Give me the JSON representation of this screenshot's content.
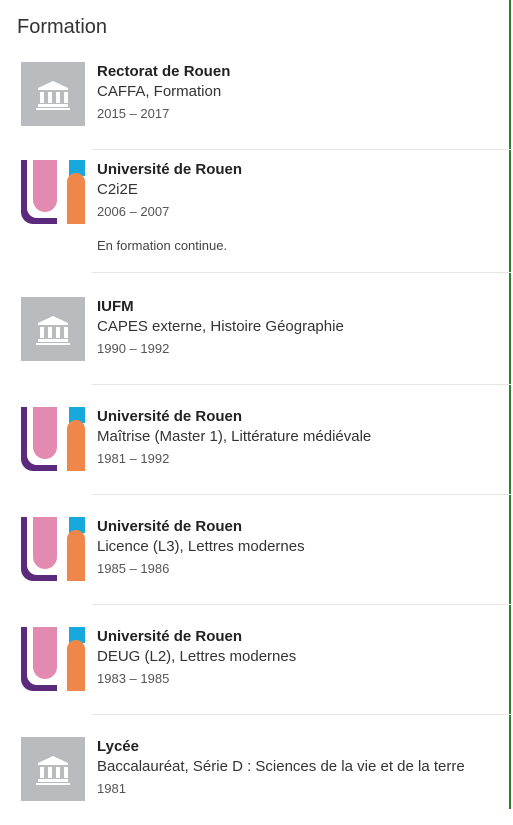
{
  "section": {
    "title": "Formation"
  },
  "icons": {
    "institution": "institution-building-icon",
    "university": "universite-rouen-logo"
  },
  "colors": {
    "logo_gray": "#b9bbbe",
    "uni_purple": "#5b2a7c",
    "uni_pink": "#e38ab0",
    "uni_blue": "#17a9dd",
    "uni_orange": "#f0874a",
    "border_green": "#2e7d32"
  },
  "items": [
    {
      "school": "Rectorat de Rouen",
      "degree": "CAFFA, Formation",
      "dates": "2015 – 2017",
      "logo": "institution"
    },
    {
      "school": "Université de Rouen",
      "degree": "C2i2E",
      "dates": "2006 – 2007",
      "note": "En formation continue.",
      "logo": "university"
    },
    {
      "school": "IUFM",
      "degree": "CAPES externe, Histoire Géographie",
      "dates": "1990 – 1992",
      "logo": "institution"
    },
    {
      "school": "Université de Rouen",
      "degree": "Maîtrise (Master 1), Littérature médiévale",
      "dates": "1981 – 1992",
      "logo": "university"
    },
    {
      "school": "Université de Rouen",
      "degree": "Licence (L3), Lettres modernes",
      "dates": "1985 – 1986",
      "logo": "university"
    },
    {
      "school": "Université de Rouen",
      "degree": "DEUG (L2), Lettres modernes",
      "dates": "1983 – 1985",
      "logo": "university"
    },
    {
      "school": "Lycée",
      "degree": "Baccalauréat, Série D : Sciences de la vie et de la terre",
      "dates": "1981",
      "logo": "institution"
    }
  ]
}
